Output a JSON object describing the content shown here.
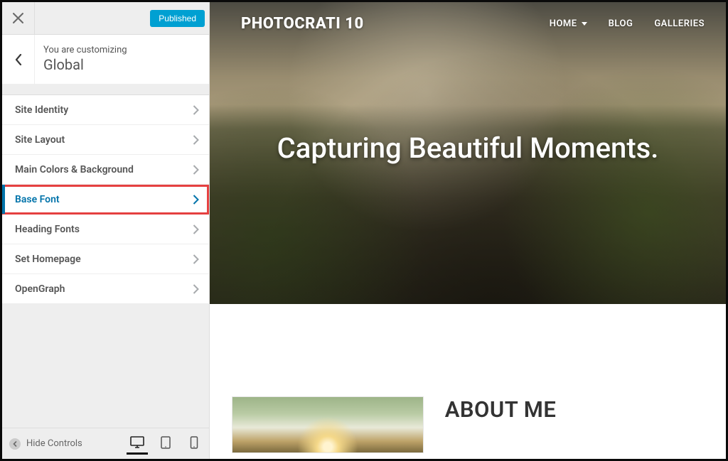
{
  "header": {
    "published_label": "Published",
    "customizing_label": "You are customizing",
    "section_title": "Global"
  },
  "menu": {
    "items": [
      {
        "label": "Site Identity",
        "active": false
      },
      {
        "label": "Site Layout",
        "active": false
      },
      {
        "label": "Main Colors & Background",
        "active": false
      },
      {
        "label": "Base Font",
        "active": true
      },
      {
        "label": "Heading Fonts",
        "active": false
      },
      {
        "label": "Set Homepage",
        "active": false
      },
      {
        "label": "OpenGraph",
        "active": false
      }
    ]
  },
  "footer": {
    "hide_controls_label": "Hide Controls"
  },
  "preview": {
    "brand": "PHOTOCRATI 10",
    "nav": {
      "home": "HOME",
      "blog": "BLOG",
      "galleries": "GALLERIES"
    },
    "hero_title": "Capturing Beautiful Moments.",
    "about_heading": "ABOUT ME"
  }
}
